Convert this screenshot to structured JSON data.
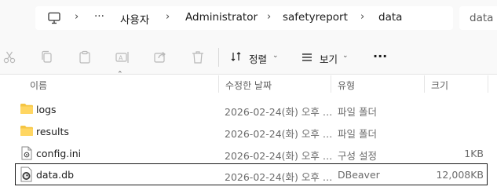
{
  "breadcrumb": {
    "overflow": "···",
    "items": [
      "사용자",
      "Administrator",
      "safetyreport",
      "data"
    ]
  },
  "search": {
    "text": "data"
  },
  "toolbar": {
    "sort_label": "정렬",
    "view_label": "보기",
    "more_label": "···"
  },
  "columns": {
    "name": "이름",
    "modified": "수정한 날짜",
    "type": "유형",
    "size": "크기"
  },
  "files": [
    {
      "name": "logs",
      "modified": "2026-02-24(화) 오후 …",
      "type": "파일 폴더",
      "size": "",
      "icon": "folder-icon"
    },
    {
      "name": "results",
      "modified": "2026-02-24(화) 오후 …",
      "type": "파일 폴더",
      "size": "",
      "icon": "folder-icon"
    },
    {
      "name": "config.ini",
      "modified": "2026-02-24(화) 오후 …",
      "type": "구성 설정",
      "size": "1KB",
      "icon": "settings-file-icon"
    },
    {
      "name": "data.db",
      "modified": "2026-02-24(화) 오후 …",
      "type": "DBeaver",
      "size": "12,008KB",
      "icon": "dbeaver-icon"
    }
  ],
  "colors": {
    "folder": "#f5c543",
    "accent": "#0067c0"
  }
}
